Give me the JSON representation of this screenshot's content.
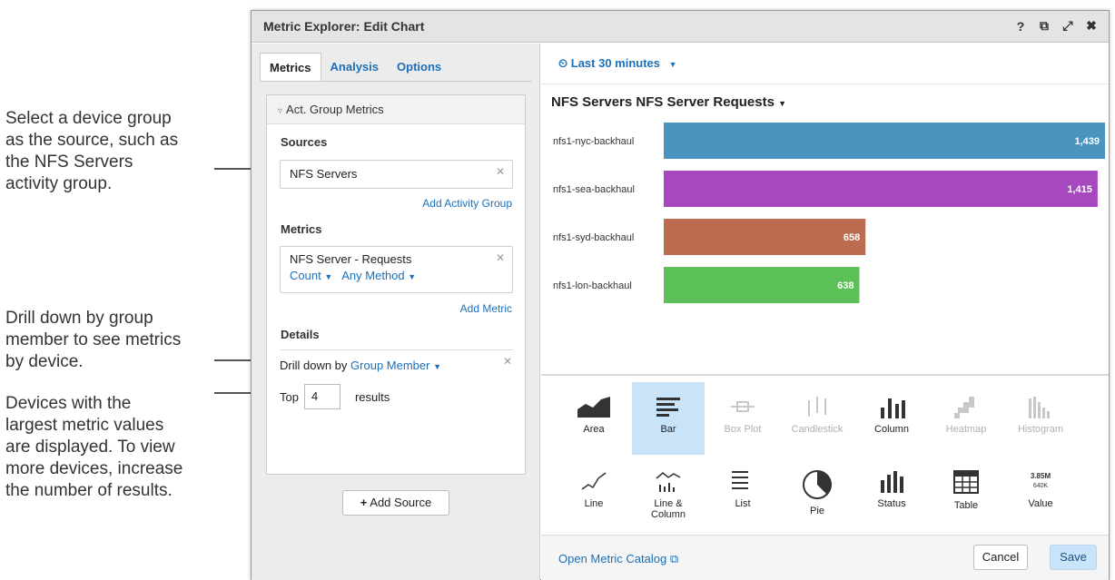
{
  "callouts": {
    "c1": "Select a device group\nas the source, such as\nthe NFS Servers\nactivity group.",
    "c2": "Drill down by group\nmember to see metrics\nby device.",
    "c3": "Devices with the\nlargest metric values\nare displayed. To view\nmore devices, increase\nthe number of results."
  },
  "window": {
    "title": "Metric Explorer: Edit Chart",
    "controls": [
      "?",
      "⧉",
      "⤢",
      "✖"
    ]
  },
  "left": {
    "tabs": [
      "Metrics",
      "Analysis",
      "Options"
    ],
    "group_header": "Act. Group Metrics",
    "sources_label": "Sources",
    "source_value": "NFS Servers",
    "add_activity_group": "Add Activity Group",
    "metrics_label": "Metrics",
    "metric_name": "NFS Server - Requests",
    "metric_agg": "Count",
    "metric_method": "Any Method",
    "add_metric": "Add Metric",
    "details_label": "Details",
    "drill_prefix": "Drill down by",
    "drill_value": "Group Member",
    "top_label": "Top",
    "top_value": "4",
    "results_label": "results",
    "add_source": "Add Source",
    "add_source_icon": "+"
  },
  "right": {
    "time_range": "Last 30 minutes",
    "chart_title": "NFS Servers NFS Server Requests",
    "chart_types": [
      {
        "label": "Area",
        "icon": "area-chart-icon",
        "state": "normal"
      },
      {
        "label": "Bar",
        "icon": "bar-chart-icon",
        "state": "selected"
      },
      {
        "label": "Box Plot",
        "icon": "box-plot-icon",
        "state": "disabled"
      },
      {
        "label": "Candlestick",
        "icon": "candlestick-icon",
        "state": "disabled"
      },
      {
        "label": "Column",
        "icon": "column-chart-icon",
        "state": "normal"
      },
      {
        "label": "Heatmap",
        "icon": "heatmap-icon",
        "state": "disabled"
      },
      {
        "label": "Histogram",
        "icon": "histogram-icon",
        "state": "disabled"
      },
      {
        "label": "Line",
        "icon": "line-chart-icon",
        "state": "normal"
      },
      {
        "label": "Line &\nColumn",
        "icon": "line-column-icon",
        "state": "normal"
      },
      {
        "label": "List",
        "icon": "list-icon",
        "state": "normal"
      },
      {
        "label": "Pie",
        "icon": "pie-chart-icon",
        "state": "normal"
      },
      {
        "label": "Status",
        "icon": "status-icon",
        "state": "normal"
      },
      {
        "label": "Table",
        "icon": "table-icon",
        "state": "normal"
      },
      {
        "label": "Value",
        "icon": "value-icon",
        "state": "normal"
      }
    ],
    "value_icon_text": [
      "3.85M",
      "640K"
    ],
    "open_catalog": "Open Metric Catalog",
    "cancel": "Cancel",
    "save": "Save"
  },
  "colors": {
    "accent": "#1d6fb8",
    "selected_bg": "#c9e3f8"
  },
  "chart_data": {
    "type": "bar",
    "orientation": "horizontal",
    "categories": [
      "nfs1-nyc-backhaul",
      "nfs1-sea-backhaul",
      "nfs1-syd-backhaul",
      "nfs1-lon-backhaul"
    ],
    "values": [
      1439,
      1415,
      658,
      638
    ],
    "value_labels": [
      "1,439",
      "1,415",
      "658",
      "638"
    ],
    "colors": [
      "#4b94c0",
      "#a649bf",
      "#bd6d4f",
      "#5cc059"
    ],
    "title": "NFS Servers NFS Server Requests"
  }
}
